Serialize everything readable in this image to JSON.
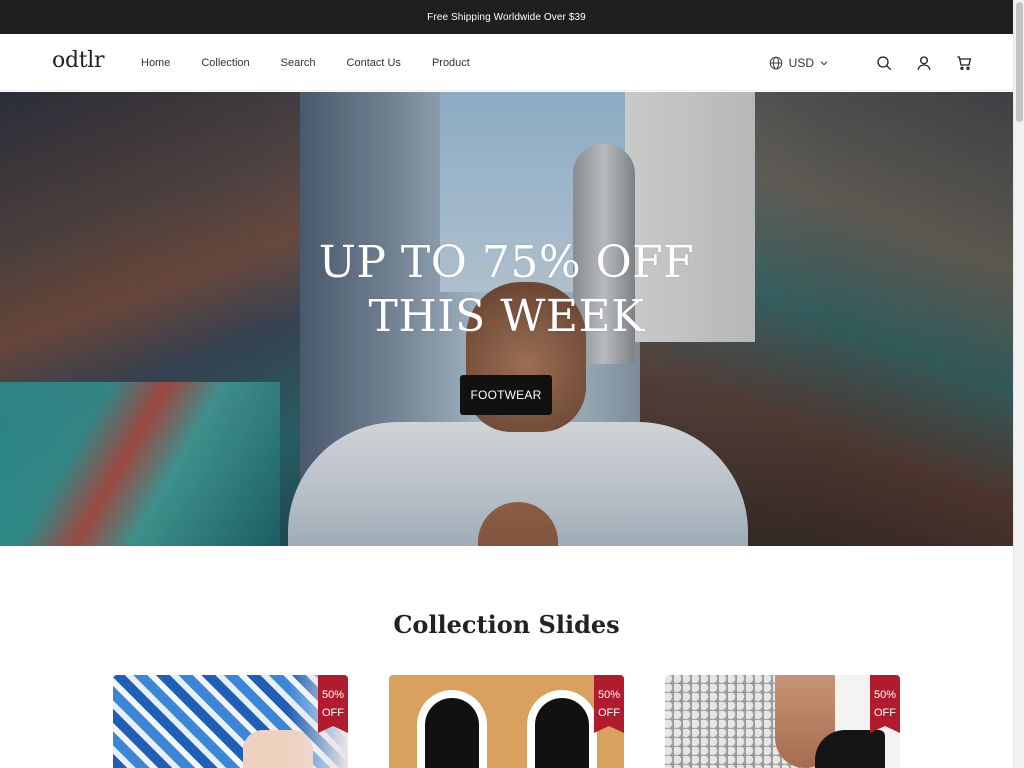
{
  "announcement": {
    "text": "Free Shipping Worldwide Over $39"
  },
  "header": {
    "logo": "odtlr",
    "nav": [
      "Home",
      "Collection",
      "Search",
      "Contact Us",
      "Product"
    ],
    "currency": "USD"
  },
  "hero": {
    "title_line1": "UP TO 75% OFF",
    "title_line2": "THIS WEEK",
    "button_label": "FOOTWEAR"
  },
  "collection": {
    "title": "Collection Slides",
    "cards": [
      {
        "badge_percent": "50%",
        "badge_off": "OFF"
      },
      {
        "badge_percent": "50%",
        "badge_off": "OFF"
      },
      {
        "badge_percent": "50%",
        "badge_off": "OFF"
      }
    ]
  },
  "colors": {
    "announcement_bg": "#1f1f1f",
    "badge": "#b01b2e",
    "button_bg": "#111111"
  },
  "icons": [
    "globe-icon",
    "chevron-down-icon",
    "search-icon",
    "user-icon",
    "cart-icon"
  ]
}
